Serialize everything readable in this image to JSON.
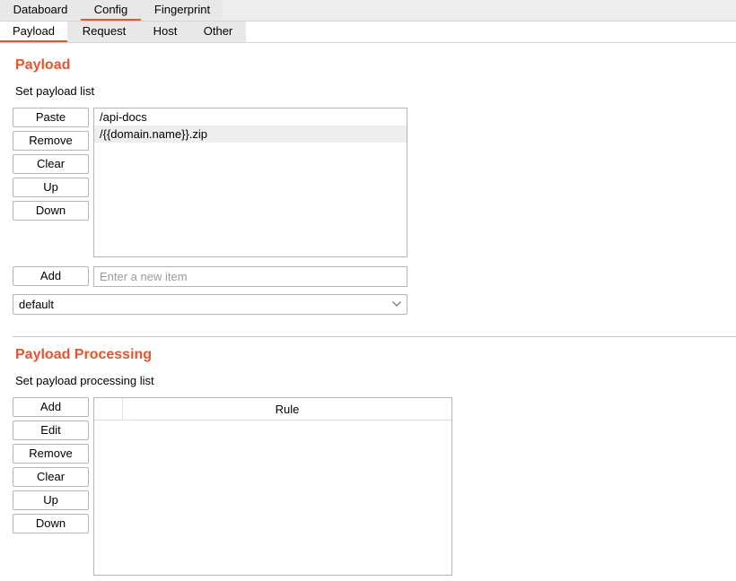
{
  "tabs": [
    {
      "label": "Databoard"
    },
    {
      "label": "Config"
    },
    {
      "label": "Fingerprint"
    }
  ],
  "subtabs": [
    {
      "label": "Payload"
    },
    {
      "label": "Request"
    },
    {
      "label": "Host"
    },
    {
      "label": "Other"
    }
  ],
  "payload": {
    "title": "Payload",
    "subtitle": "Set payload list",
    "buttons": {
      "paste": "Paste",
      "remove": "Remove",
      "clear": "Clear",
      "up": "Up",
      "down": "Down",
      "add": "Add"
    },
    "items": [
      "/api-docs",
      "/{{domain.name}}.zip"
    ],
    "new_item_placeholder": "Enter a new item",
    "select_value": "default"
  },
  "processing": {
    "title": "Payload Processing",
    "subtitle": "Set payload processing list",
    "buttons": {
      "add": "Add",
      "edit": "Edit",
      "remove": "Remove",
      "clear": "Clear",
      "up": "Up",
      "down": "Down"
    },
    "columns": [
      "",
      "Rule"
    ]
  },
  "colors": {
    "accent": "#e8542c"
  }
}
